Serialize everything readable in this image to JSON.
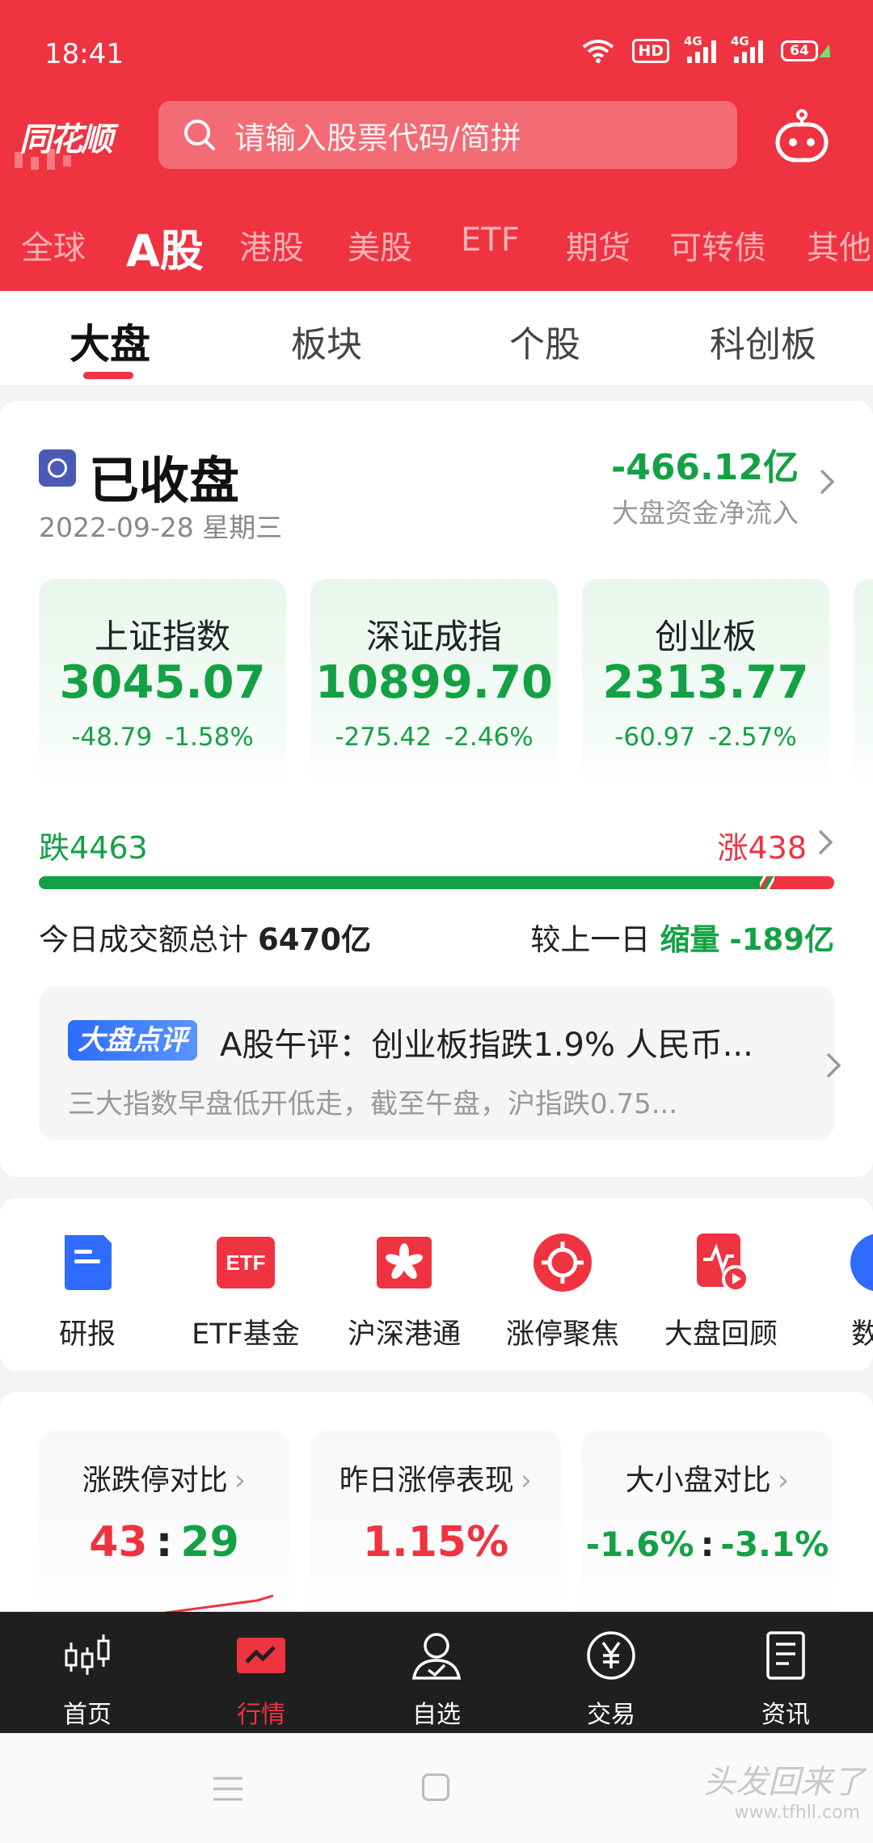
{
  "status_bar": {
    "time": "18:41",
    "hd": "HD",
    "signal1": "4G",
    "signal2": "4G",
    "battery": "64"
  },
  "header": {
    "logo": "同花顺",
    "search_placeholder": "请输入股票代码/简拼",
    "market_tabs": [
      "全球",
      "A股",
      "港股",
      "美股",
      "ETF",
      "期货",
      "可转债",
      "其他"
    ],
    "active_market_tab": "A股"
  },
  "sub_tabs": [
    "大盘",
    "板块",
    "个股",
    "科创板"
  ],
  "market": {
    "status": "已收盘",
    "date": "2022-09-28 星期三",
    "net_flow_value": "-466.12亿",
    "net_flow_label": "大盘资金净流入",
    "indices": [
      {
        "name": "上证指数",
        "value": "3045.07",
        "change": "-48.79",
        "pct": "-1.58%"
      },
      {
        "name": "深证成指",
        "value": "10899.70",
        "change": "-275.42",
        "pct": "-2.46%"
      },
      {
        "name": "创业板",
        "value": "2313.77",
        "change": "-60.97",
        "pct": "-2.57%"
      }
    ],
    "fall_count": "跌4463",
    "rise_count": "涨438",
    "fall_ratio": 0.9107,
    "turnover_label": "今日成交额总计",
    "turnover_value": "6470亿",
    "compare_label": "较上一日",
    "compare_tag": "缩量",
    "compare_value": "-189亿",
    "news_tag": "大盘点评",
    "news_title": "A股午评：创业板指跌1.9% 人民币...",
    "news_summary": "三大指数早盘低开低走，截至午盘，沪指跌0.75..."
  },
  "shortcuts": [
    {
      "label": "研报",
      "icon": "report-icon"
    },
    {
      "label": "ETF基金",
      "icon": "etf-icon"
    },
    {
      "label": "沪深港通",
      "icon": "hk-connect-icon"
    },
    {
      "label": "涨停聚焦",
      "icon": "target-icon"
    },
    {
      "label": "大盘回顾",
      "icon": "review-video-icon"
    },
    {
      "label": "数据",
      "icon": "data-icon"
    }
  ],
  "compare_cards": [
    {
      "title": "涨跌停对比",
      "left": "43",
      "sep": ":",
      "right": "29"
    },
    {
      "title": "昨日涨停表现",
      "value": "1.15%"
    },
    {
      "title": "大小盘对比",
      "left": "-1.6%",
      "sep": ":",
      "right": "-3.1%"
    }
  ],
  "chevron": "›",
  "bottom_nav": [
    {
      "label": "首页",
      "icon": "candlestick-icon"
    },
    {
      "label": "行情",
      "icon": "market-chart-icon"
    },
    {
      "label": "自选",
      "icon": "user-check-icon"
    },
    {
      "label": "交易",
      "icon": "yen-icon"
    },
    {
      "label": "资讯",
      "icon": "news-doc-icon"
    }
  ],
  "active_nav": "行情",
  "watermark": "头发回来了",
  "watermark_url": "www.tfhll.com",
  "colors": {
    "brand_red": "#ef3340",
    "down_green": "#14a145",
    "nav_bg": "#1f1f1f"
  }
}
